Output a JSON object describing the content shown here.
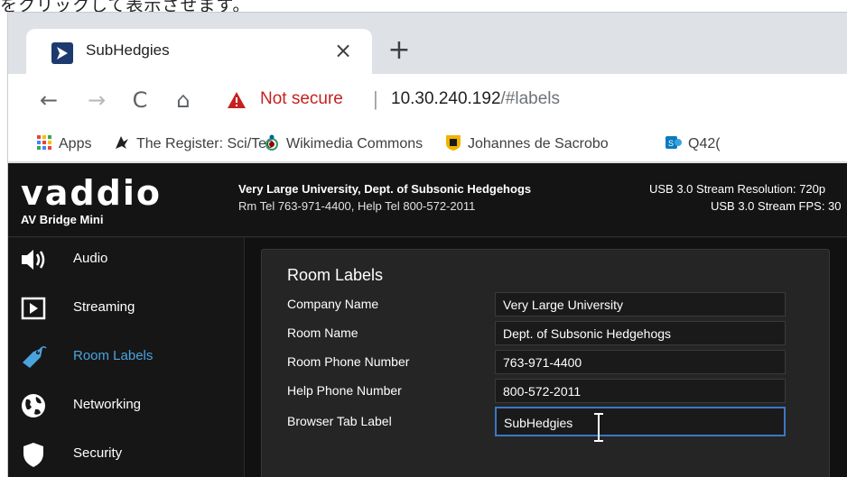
{
  "caption": "をクリックして表示させます。",
  "browser": {
    "tab_title": "SubHedgies",
    "tab_close": "×",
    "new_tab": "+",
    "nav": {
      "back": "←",
      "forward": "→",
      "reload": "C",
      "home": "⌂"
    },
    "not_secure": "Not secure",
    "separator": "|",
    "url_host": "10.30.240.192",
    "url_path": "/#labels",
    "bookmarks": [
      {
        "label": "Apps",
        "icon": "apps-grid-icon"
      },
      {
        "label": "The Register: Sci/Tec",
        "icon": "register-vulture-icon"
      },
      {
        "label": "Wikimedia Commons",
        "icon": "wikimedia-icon"
      },
      {
        "label": "Johannes de Sacrobo",
        "icon": "shield-logo-icon"
      },
      {
        "label": "Q42(",
        "icon": "sharepoint-icon"
      }
    ]
  },
  "header": {
    "logo": "vaddio",
    "model": "AV Bridge Mini",
    "site_name": "Very Large University, Dept. of Subsonic Hedgehogs",
    "site_contact": "Rm Tel 763-971-4400, Help Tel 800-572-2011",
    "stream_resolution": "USB 3.0 Stream Resolution: 720p",
    "stream_fps": "USB 3.0 Stream FPS: 30"
  },
  "sidebar": {
    "items": [
      {
        "label": "Audio",
        "icon": "speaker-icon",
        "active": false
      },
      {
        "label": "Streaming",
        "icon": "play-icon",
        "active": false
      },
      {
        "label": "Room Labels",
        "icon": "tag-icon",
        "active": true
      },
      {
        "label": "Networking",
        "icon": "globe-icon",
        "active": false
      },
      {
        "label": "Security",
        "icon": "shield-icon",
        "active": false
      }
    ]
  },
  "room_labels": {
    "title": "Room Labels",
    "fields": [
      {
        "label": "Company Name",
        "value": "Very Large University"
      },
      {
        "label": "Room Name",
        "value": "Dept. of Subsonic Hedgehogs"
      },
      {
        "label": "Room Phone Number",
        "value": "763-971-4400"
      },
      {
        "label": "Help Phone Number",
        "value": "800-572-2011"
      },
      {
        "label": "Browser Tab Label",
        "value": "SubHedgies"
      }
    ]
  },
  "colors": {
    "accent": "#4aa3df",
    "warning": "#c5221f",
    "focus": "#3b77c4",
    "page_bg": "#1b1b1b"
  }
}
